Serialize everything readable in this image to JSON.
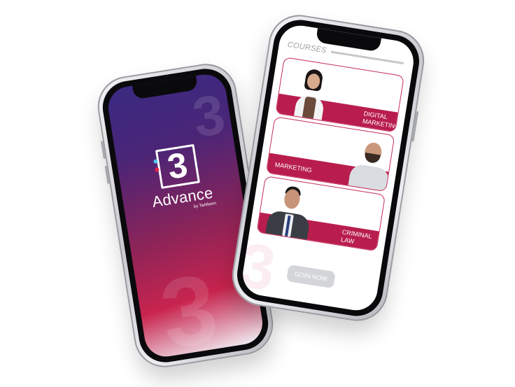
{
  "splash": {
    "brand_digit": "3",
    "title": "Advance",
    "subtitle": "by TaAlleem"
  },
  "courses": {
    "heading": "COURSES",
    "items": [
      {
        "label_line1": "DIGITAL",
        "label_line2": "MARKETING"
      },
      {
        "label_line1": "MARKETING",
        "label_line2": ""
      },
      {
        "label_line1": "CRIMINAL",
        "label_line2": "LAW"
      }
    ],
    "join_label": "GOIN NOW"
  },
  "colors": {
    "accent": "#b81d4d",
    "splash_gradient_top": "#3a2a82",
    "splash_gradient_bottom": "#c8244e",
    "button_gray": "#d4d5d9"
  }
}
